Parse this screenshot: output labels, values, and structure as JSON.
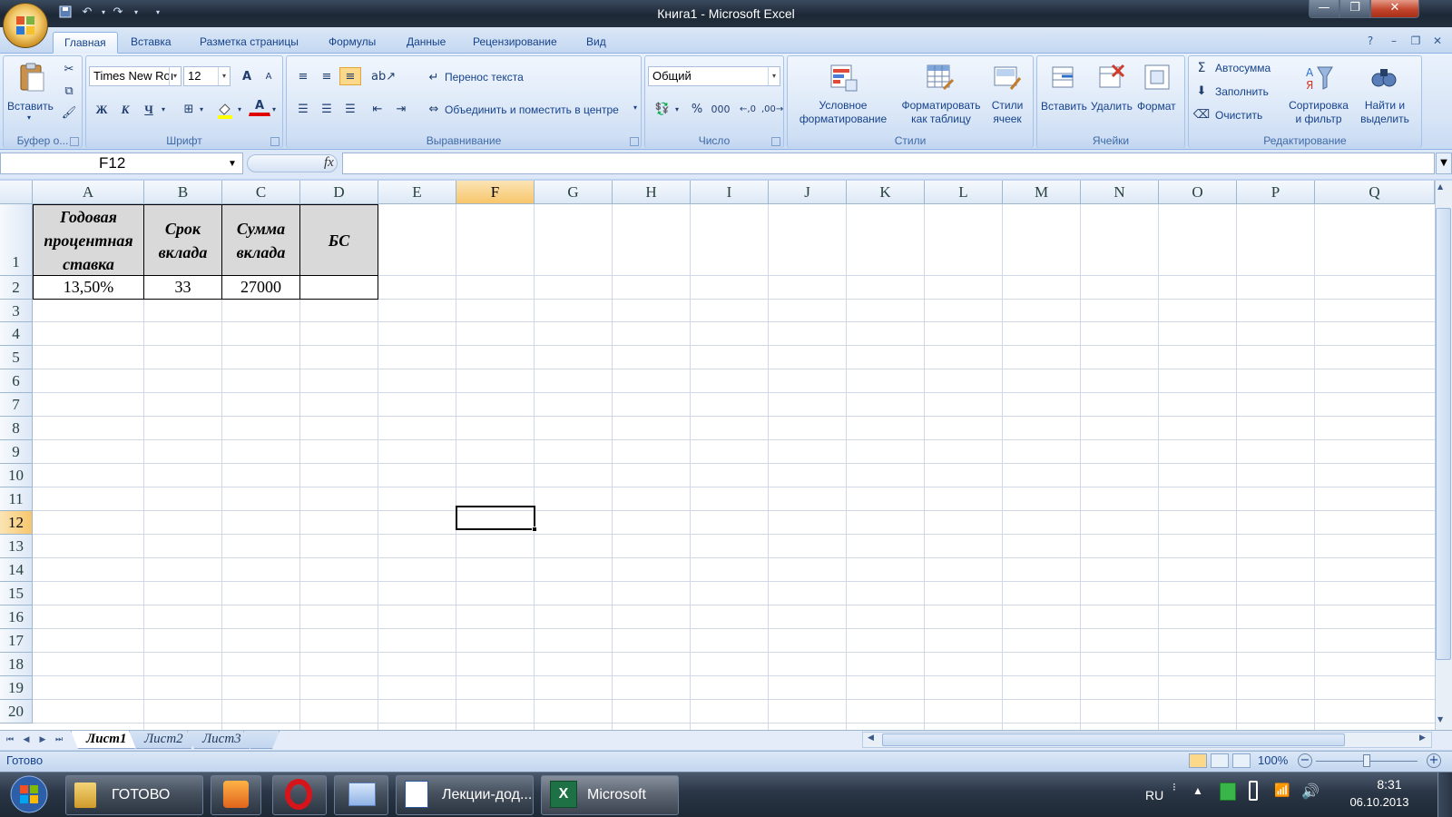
{
  "window": {
    "title": "Книга1 - Microsoft Excel",
    "minimize_glyph": "—",
    "maximize_glyph": "❐",
    "close_glyph": "✕"
  },
  "ribbon_tabs": [
    "Главная",
    "Вставка",
    "Разметка страницы",
    "Формулы",
    "Данные",
    "Рецензирование",
    "Вид"
  ],
  "ribbon_active_tab": "Главная",
  "clipboard": {
    "paste_label": "Вставить",
    "group_label": "Буфер о..."
  },
  "font": {
    "name_value": "Times New Roı",
    "size_value": "12",
    "bold": "Ж",
    "italic": "К",
    "underline": "Ч",
    "grow": "A",
    "shrink": "A",
    "color_letter": "A",
    "group_label": "Шрифт"
  },
  "alignment": {
    "wrap_text": "Перенос текста",
    "merge_center": "Объединить и поместить в центре",
    "group_label": "Выравнивание"
  },
  "number": {
    "format_value": "Общий",
    "percent": "%",
    "thousands": "000",
    "group_label": "Число"
  },
  "styles": {
    "conditional_l1": "Условное",
    "conditional_l2": "форматирование",
    "table_l1": "Форматировать",
    "table_l2": "как таблицу",
    "cell_styles_l1": "Стили",
    "cell_styles_l2": "ячеек",
    "group_label": "Стили"
  },
  "cells_group": {
    "insert": "Вставить",
    "delete": "Удалить",
    "format": "Формат",
    "group_label": "Ячейки"
  },
  "editing": {
    "autosum": "Автосумма",
    "fill": "Заполнить",
    "clear": "Очистить",
    "sort_l1": "Сортировка",
    "sort_l2": "и фильтр",
    "find_l1": "Найти и",
    "find_l2": "выделить",
    "group_label": "Редактирование"
  },
  "formula_bar": {
    "name_box": "F12",
    "fx_label": "fx",
    "formula": ""
  },
  "sheet": {
    "columns": [
      "A",
      "B",
      "C",
      "D",
      "E",
      "F",
      "G",
      "H",
      "I",
      "J",
      "K",
      "L",
      "M",
      "N",
      "O",
      "P",
      "Q"
    ],
    "rows": [
      "1",
      "2",
      "3",
      "4",
      "5",
      "6",
      "7",
      "8",
      "9",
      "10",
      "11",
      "12",
      "13",
      "14",
      "15",
      "16",
      "17",
      "18",
      "19",
      "20"
    ],
    "selected_column": "F",
    "selected_row": "12",
    "header_cells": {
      "A1_l1": "Годовая",
      "A1_l2": "процентная",
      "A1_l3": "ставка",
      "B1_l1": "Срок",
      "B1_l2": "вклада",
      "C1_l1": "Сумма",
      "C1_l2": "вклада",
      "D1": "БС"
    },
    "data_cells": {
      "A2": "13,50%",
      "B2": "33",
      "C2": "27000",
      "D2": ""
    }
  },
  "sheet_tabs": [
    "Лист1",
    "Лист2",
    "Лист3"
  ],
  "active_sheet": "Лист1",
  "status": {
    "ready": "Готово",
    "zoom": "100%"
  },
  "taskbar": {
    "items": [
      "ГОТОВО",
      "Лекции-дод...",
      "Microsoft Ex..."
    ],
    "lang": "RU",
    "time": "8:31",
    "date": "06.10.2013"
  }
}
